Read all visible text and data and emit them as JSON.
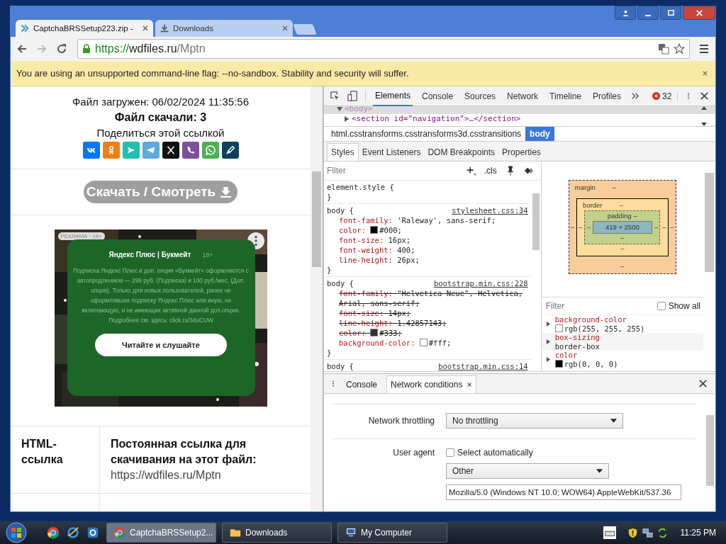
{
  "browser": {
    "tabs": [
      {
        "title": "CaptchaBRSSetup223.zip -",
        "kind": "page",
        "selected": true
      },
      {
        "title": "Downloads",
        "kind": "download",
        "selected": false
      }
    ],
    "address": {
      "scheme": "https://",
      "host": "wdfiles.ru",
      "path": "/Mptn"
    },
    "infobar": {
      "message": "You are using an unsupported command-line flag: --no-sandbox. Stability and security will suffer."
    }
  },
  "page": {
    "uploaded": "Файл загружен: 06/02/2024 11:35:56",
    "downloads": "Файл скачали: 3",
    "share_label": "Поделиться этой ссылкой",
    "share_buttons": [
      {
        "kind": "vk",
        "color": "#0077ff"
      },
      {
        "kind": "ok",
        "color": "#f08014"
      },
      {
        "kind": "send",
        "color": "#1ec0b4"
      },
      {
        "kind": "telegram",
        "color": "#5ea9dd"
      },
      {
        "kind": "x",
        "color": "#111111"
      },
      {
        "kind": "viber",
        "color": "#7b519d"
      },
      {
        "kind": "whatsapp",
        "color": "#4caf50"
      },
      {
        "kind": "pen",
        "color": "#0d425a"
      }
    ],
    "download_button": "Скачать / Смотреть",
    "ad": {
      "label": "РЕКЛАМА · 16+",
      "brand": "Яндекс Плюс | Букмейт",
      "age": "18+",
      "disclaimer": "Подписка Яндекс Плюс и доп. опция «Букмейт» оформляются с автопродлением — 299 руб. (Подписка) и 100 руб./мес. (Доп. опция). Только для новых пользователей, ранее не оформлявших подписку Яндекс Плюс или иную, не включающую, и не имеющих активной данной доп.опции. Подробнее см. здесь: click.ru/34uCUW",
      "cta": "Читайте и слушайте"
    },
    "link_row": {
      "label": "HTML-ссылка",
      "title": "Постоянная ссылка для скачивания на этот файл:",
      "url": "https://wdfiles.ru/Mptn"
    }
  },
  "devtools": {
    "tabs": [
      {
        "label": "Elements",
        "selected": true
      },
      {
        "label": "Console",
        "selected": false
      },
      {
        "label": "Sources",
        "selected": false
      },
      {
        "label": "Network",
        "selected": false
      },
      {
        "label": "Timeline",
        "selected": false
      },
      {
        "label": "Profiles",
        "selected": false
      }
    ],
    "error_count": "32",
    "dom": [
      {
        "text": "<body>",
        "expanded": true,
        "selected": true
      },
      {
        "text": "<section id=\"navigation\">…</section>",
        "expanded": false,
        "selected": false
      }
    ],
    "breadcrumbs": [
      {
        "text": "html.csstransforms.csstransforms3d.csstransitions",
        "selected": false
      },
      {
        "text": "body",
        "selected": true
      }
    ],
    "subtabs": [
      {
        "label": "Styles",
        "selected": true
      },
      {
        "label": "Event Listeners",
        "selected": false
      },
      {
        "label": "DOM Breakpoints",
        "selected": false
      },
      {
        "label": "Properties",
        "selected": false
      }
    ],
    "filter_placeholder": "Filter",
    "cls": ".cls",
    "rules": [
      {
        "selector": "element.style {",
        "close": "}"
      },
      {
        "selector": "body {",
        "source": "stylesheet.css:34",
        "close": "}",
        "props": [
          {
            "name": "font-family:",
            "value": "'Raleway', sans-serif;",
            "struck": false
          },
          {
            "name": "color:",
            "value": "#000;",
            "color": "#000000",
            "struck": false
          },
          {
            "name": "font-size:",
            "value": "16px;",
            "struck": false
          },
          {
            "name": "font-weight:",
            "value": "400;",
            "struck": false
          },
          {
            "name": "line-height:",
            "value": "26px;",
            "struck": false
          }
        ]
      },
      {
        "selector": "body {",
        "source": "bootstrap.min.css:228",
        "close": "}",
        "props": [
          {
            "name": "font-family:",
            "value": "\"Helvetica Neue\", Helvetica, Arial, sans-serif;",
            "struck": true
          },
          {
            "name": "font-size:",
            "value": "14px;",
            "struck": true
          },
          {
            "name": "line-height:",
            "value": "1.42857143;",
            "struck": true
          },
          {
            "name": "color:",
            "value": "#333;",
            "color": "#333333",
            "struck": true
          },
          {
            "name": "background-color:",
            "value": "#fff;",
            "color": "#ffffff",
            "struck": false
          }
        ]
      },
      {
        "selector": "body {",
        "source": "bootstrap.min.css:14"
      }
    ],
    "box_model": {
      "margin": {
        "label": "margin",
        "top": "–",
        "right": "–",
        "bottom": "–",
        "left": "–"
      },
      "border": {
        "label": "border",
        "top": "–",
        "right": "–",
        "bottom": "–",
        "left": "–"
      },
      "padding": {
        "label": "padding",
        "top": "–",
        "right": "–",
        "bottom": "–",
        "left": "–"
      },
      "content": "419 × 2500"
    },
    "computed": {
      "filter_placeholder": "Filter",
      "show_all": {
        "label": "Show all",
        "checked": false
      },
      "props": [
        {
          "name": "background-color",
          "value": "rgb(255, 255, 255)",
          "color": "#ffffff"
        },
        {
          "name": "box-sizing",
          "value": "border-box"
        },
        {
          "name": "color",
          "value": "rgb(0, 0, 0)",
          "color": "#000000"
        }
      ]
    },
    "drawer": {
      "tabs": [
        {
          "label": "Console",
          "selected": false
        },
        {
          "label": "Network conditions",
          "selected": true
        }
      ],
      "throttling": {
        "label": "Network throttling",
        "value": "No throttling"
      },
      "user_agent": {
        "label": "User agent",
        "auto": {
          "label": "Select automatically",
          "checked": false
        },
        "preset": "Other",
        "value": "Mozilla/5.0 (Windows NT 10.0; WOW64) AppleWebKit/537.36"
      }
    }
  },
  "taskbar": {
    "tasks": [
      {
        "title": "CaptchaBRSSetup2...",
        "kind": "browser",
        "selected": true
      },
      {
        "title": "Downloads",
        "kind": "folder",
        "selected": false
      },
      {
        "title": "My Computer",
        "kind": "computer",
        "selected": false
      }
    ],
    "clock": "11:25 PM"
  }
}
